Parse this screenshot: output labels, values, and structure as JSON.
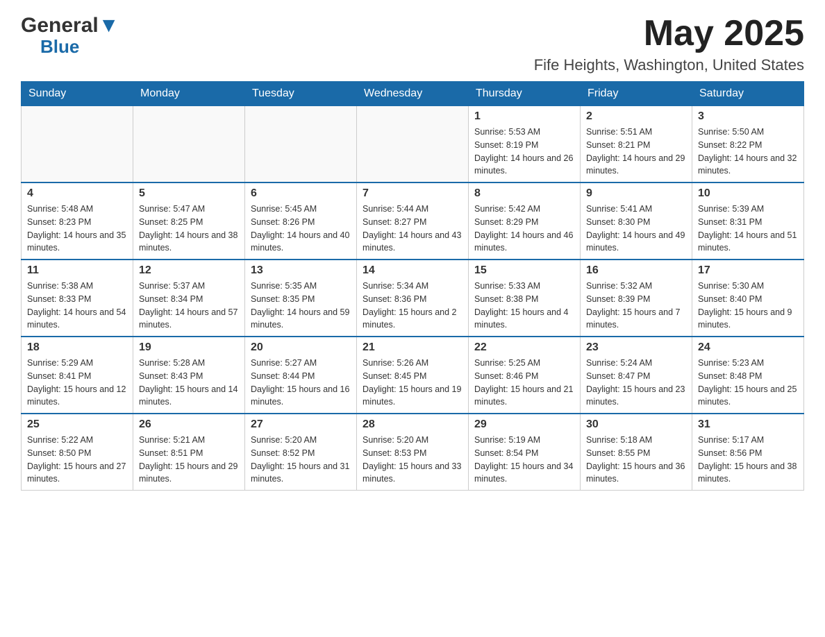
{
  "header": {
    "logo_general": "General",
    "logo_blue": "Blue",
    "month_title": "May 2025",
    "location": "Fife Heights, Washington, United States"
  },
  "days_of_week": [
    "Sunday",
    "Monday",
    "Tuesday",
    "Wednesday",
    "Thursday",
    "Friday",
    "Saturday"
  ],
  "weeks": [
    [
      {
        "day": "",
        "sunrise": "",
        "sunset": "",
        "daylight": ""
      },
      {
        "day": "",
        "sunrise": "",
        "sunset": "",
        "daylight": ""
      },
      {
        "day": "",
        "sunrise": "",
        "sunset": "",
        "daylight": ""
      },
      {
        "day": "",
        "sunrise": "",
        "sunset": "",
        "daylight": ""
      },
      {
        "day": "1",
        "sunrise": "Sunrise: 5:53 AM",
        "sunset": "Sunset: 8:19 PM",
        "daylight": "Daylight: 14 hours and 26 minutes."
      },
      {
        "day": "2",
        "sunrise": "Sunrise: 5:51 AM",
        "sunset": "Sunset: 8:21 PM",
        "daylight": "Daylight: 14 hours and 29 minutes."
      },
      {
        "day": "3",
        "sunrise": "Sunrise: 5:50 AM",
        "sunset": "Sunset: 8:22 PM",
        "daylight": "Daylight: 14 hours and 32 minutes."
      }
    ],
    [
      {
        "day": "4",
        "sunrise": "Sunrise: 5:48 AM",
        "sunset": "Sunset: 8:23 PM",
        "daylight": "Daylight: 14 hours and 35 minutes."
      },
      {
        "day": "5",
        "sunrise": "Sunrise: 5:47 AM",
        "sunset": "Sunset: 8:25 PM",
        "daylight": "Daylight: 14 hours and 38 minutes."
      },
      {
        "day": "6",
        "sunrise": "Sunrise: 5:45 AM",
        "sunset": "Sunset: 8:26 PM",
        "daylight": "Daylight: 14 hours and 40 minutes."
      },
      {
        "day": "7",
        "sunrise": "Sunrise: 5:44 AM",
        "sunset": "Sunset: 8:27 PM",
        "daylight": "Daylight: 14 hours and 43 minutes."
      },
      {
        "day": "8",
        "sunrise": "Sunrise: 5:42 AM",
        "sunset": "Sunset: 8:29 PM",
        "daylight": "Daylight: 14 hours and 46 minutes."
      },
      {
        "day": "9",
        "sunrise": "Sunrise: 5:41 AM",
        "sunset": "Sunset: 8:30 PM",
        "daylight": "Daylight: 14 hours and 49 minutes."
      },
      {
        "day": "10",
        "sunrise": "Sunrise: 5:39 AM",
        "sunset": "Sunset: 8:31 PM",
        "daylight": "Daylight: 14 hours and 51 minutes."
      }
    ],
    [
      {
        "day": "11",
        "sunrise": "Sunrise: 5:38 AM",
        "sunset": "Sunset: 8:33 PM",
        "daylight": "Daylight: 14 hours and 54 minutes."
      },
      {
        "day": "12",
        "sunrise": "Sunrise: 5:37 AM",
        "sunset": "Sunset: 8:34 PM",
        "daylight": "Daylight: 14 hours and 57 minutes."
      },
      {
        "day": "13",
        "sunrise": "Sunrise: 5:35 AM",
        "sunset": "Sunset: 8:35 PM",
        "daylight": "Daylight: 14 hours and 59 minutes."
      },
      {
        "day": "14",
        "sunrise": "Sunrise: 5:34 AM",
        "sunset": "Sunset: 8:36 PM",
        "daylight": "Daylight: 15 hours and 2 minutes."
      },
      {
        "day": "15",
        "sunrise": "Sunrise: 5:33 AM",
        "sunset": "Sunset: 8:38 PM",
        "daylight": "Daylight: 15 hours and 4 minutes."
      },
      {
        "day": "16",
        "sunrise": "Sunrise: 5:32 AM",
        "sunset": "Sunset: 8:39 PM",
        "daylight": "Daylight: 15 hours and 7 minutes."
      },
      {
        "day": "17",
        "sunrise": "Sunrise: 5:30 AM",
        "sunset": "Sunset: 8:40 PM",
        "daylight": "Daylight: 15 hours and 9 minutes."
      }
    ],
    [
      {
        "day": "18",
        "sunrise": "Sunrise: 5:29 AM",
        "sunset": "Sunset: 8:41 PM",
        "daylight": "Daylight: 15 hours and 12 minutes."
      },
      {
        "day": "19",
        "sunrise": "Sunrise: 5:28 AM",
        "sunset": "Sunset: 8:43 PM",
        "daylight": "Daylight: 15 hours and 14 minutes."
      },
      {
        "day": "20",
        "sunrise": "Sunrise: 5:27 AM",
        "sunset": "Sunset: 8:44 PM",
        "daylight": "Daylight: 15 hours and 16 minutes."
      },
      {
        "day": "21",
        "sunrise": "Sunrise: 5:26 AM",
        "sunset": "Sunset: 8:45 PM",
        "daylight": "Daylight: 15 hours and 19 minutes."
      },
      {
        "day": "22",
        "sunrise": "Sunrise: 5:25 AM",
        "sunset": "Sunset: 8:46 PM",
        "daylight": "Daylight: 15 hours and 21 minutes."
      },
      {
        "day": "23",
        "sunrise": "Sunrise: 5:24 AM",
        "sunset": "Sunset: 8:47 PM",
        "daylight": "Daylight: 15 hours and 23 minutes."
      },
      {
        "day": "24",
        "sunrise": "Sunrise: 5:23 AM",
        "sunset": "Sunset: 8:48 PM",
        "daylight": "Daylight: 15 hours and 25 minutes."
      }
    ],
    [
      {
        "day": "25",
        "sunrise": "Sunrise: 5:22 AM",
        "sunset": "Sunset: 8:50 PM",
        "daylight": "Daylight: 15 hours and 27 minutes."
      },
      {
        "day": "26",
        "sunrise": "Sunrise: 5:21 AM",
        "sunset": "Sunset: 8:51 PM",
        "daylight": "Daylight: 15 hours and 29 minutes."
      },
      {
        "day": "27",
        "sunrise": "Sunrise: 5:20 AM",
        "sunset": "Sunset: 8:52 PM",
        "daylight": "Daylight: 15 hours and 31 minutes."
      },
      {
        "day": "28",
        "sunrise": "Sunrise: 5:20 AM",
        "sunset": "Sunset: 8:53 PM",
        "daylight": "Daylight: 15 hours and 33 minutes."
      },
      {
        "day": "29",
        "sunrise": "Sunrise: 5:19 AM",
        "sunset": "Sunset: 8:54 PM",
        "daylight": "Daylight: 15 hours and 34 minutes."
      },
      {
        "day": "30",
        "sunrise": "Sunrise: 5:18 AM",
        "sunset": "Sunset: 8:55 PM",
        "daylight": "Daylight: 15 hours and 36 minutes."
      },
      {
        "day": "31",
        "sunrise": "Sunrise: 5:17 AM",
        "sunset": "Sunset: 8:56 PM",
        "daylight": "Daylight: 15 hours and 38 minutes."
      }
    ]
  ]
}
